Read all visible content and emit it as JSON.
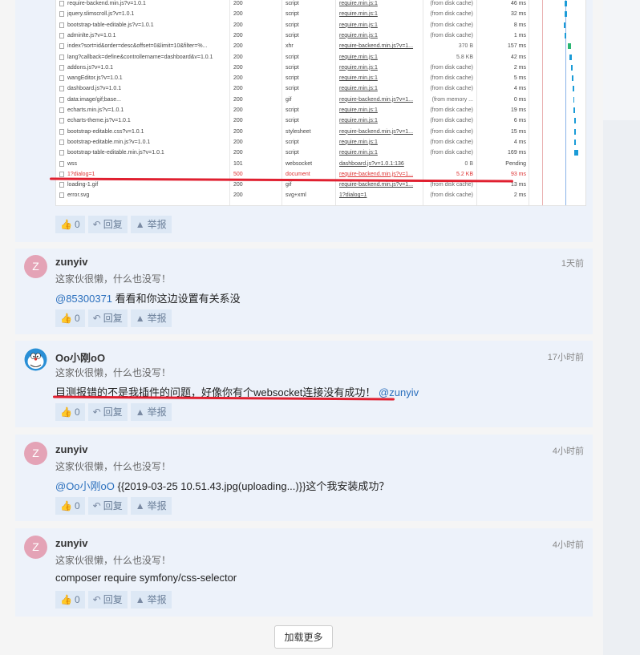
{
  "network": {
    "rows": [
      {
        "name": "require-backend.min.js?v=1.0.1",
        "status": "200",
        "type": "script",
        "initiator": "require.min.js:1",
        "size": "(from disk cache)",
        "time": "46 ms"
      },
      {
        "name": "jquery.slimscroll.js?v=1.0.1",
        "status": "200",
        "type": "script",
        "initiator": "require.min.js:1",
        "size": "(from disk cache)",
        "time": "32 ms"
      },
      {
        "name": "bootstrap-table-editable.js?v=1.0.1",
        "status": "200",
        "type": "script",
        "initiator": "require.min.js:1",
        "size": "(from disk cache)",
        "time": "8 ms"
      },
      {
        "name": "adminlte.js?v=1.0.1",
        "status": "200",
        "type": "script",
        "initiator": "require.min.js:1",
        "size": "(from disk cache)",
        "time": "1 ms"
      },
      {
        "name": "index?sort=id&order=desc&offset=0&limit=10&filter=%...",
        "status": "200",
        "type": "xhr",
        "initiator": "require-backend.min.js?v=1...",
        "size": "370 B",
        "time": "157 ms"
      },
      {
        "name": "lang?callback=define&controllername=dashboard&v=1.0.1",
        "status": "200",
        "type": "script",
        "initiator": "require.min.js:1",
        "size": "5.8 KB",
        "time": "42 ms"
      },
      {
        "name": "addons.js?v=1.0.1",
        "status": "200",
        "type": "script",
        "initiator": "require.min.js:1",
        "size": "(from disk cache)",
        "time": "2 ms"
      },
      {
        "name": "wangEditor.js?v=1.0.1",
        "status": "200",
        "type": "script",
        "initiator": "require.min.js:1",
        "size": "(from disk cache)",
        "time": "5 ms"
      },
      {
        "name": "dashboard.js?v=1.0.1",
        "status": "200",
        "type": "script",
        "initiator": "require.min.js:1",
        "size": "(from disk cache)",
        "time": "4 ms"
      },
      {
        "name": "data:image/gif;base...",
        "status": "200",
        "type": "gif",
        "initiator": "require-backend.min.js?v=1...",
        "size": "(from memory ...",
        "time": "0 ms"
      },
      {
        "name": "echarts.min.js?v=1.0.1",
        "status": "200",
        "type": "script",
        "initiator": "require.min.js:1",
        "size": "(from disk cache)",
        "time": "19 ms"
      },
      {
        "name": "echarts-theme.js?v=1.0.1",
        "status": "200",
        "type": "script",
        "initiator": "require.min.js:1",
        "size": "(from disk cache)",
        "time": "6 ms"
      },
      {
        "name": "bootstrap-editable.css?v=1.0.1",
        "status": "200",
        "type": "stylesheet",
        "initiator": "require-backend.min.js?v=1...",
        "size": "(from disk cache)",
        "time": "15 ms"
      },
      {
        "name": "bootstrap-editable.min.js?v=1.0.1",
        "status": "200",
        "type": "script",
        "initiator": "require.min.js:1",
        "size": "(from disk cache)",
        "time": "4 ms"
      },
      {
        "name": "bootstrap-table-editable.min.js?v=1.0.1",
        "status": "200",
        "type": "script",
        "initiator": "require.min.js:1",
        "size": "(from disk cache)",
        "time": "169 ms"
      },
      {
        "name": "wss",
        "status": "101",
        "type": "websocket",
        "initiator": "dashboard.js?v=1.0.1:136",
        "size": "0 B",
        "time": "Pending"
      },
      {
        "name": "1?dialog=1",
        "status": "500",
        "type": "document",
        "initiator": "require-backend.min.js?v=1...",
        "size": "5.2 KB",
        "time": "93 ms",
        "error": true
      },
      {
        "name": "loading-1.gif",
        "status": "200",
        "type": "gif",
        "initiator": "require-backend.min.js?v=1...",
        "size": "(from disk cache)",
        "time": "13 ms"
      },
      {
        "name": "error.svg",
        "status": "200",
        "type": "svg+xml",
        "initiator": "1?dialog=1",
        "size": "(from disk cache)",
        "time": "2 ms"
      }
    ]
  },
  "actions": {
    "like_count": "0",
    "reply": "回复",
    "report": "举报"
  },
  "comments": [
    {
      "avatar": "Z",
      "user": "zunyiv",
      "signature": "这家伙很懒，什么也没写！",
      "time": "1天前",
      "mention": "@85300371",
      "text": " 看看和你这边设置有关系没"
    },
    {
      "avatar": "",
      "user": "Oo小刚oO",
      "signature": "这家伙很懒，什么也没写！",
      "time": "17小时前",
      "text": "目测报错的不是我插件的问题，好像你有个websocket连接没有成功！",
      "mention": "@zunyiv"
    },
    {
      "avatar": "Z",
      "user": "zunyiv",
      "signature": "这家伙很懒，什么也没写！",
      "time": "4小时前",
      "mention": "@Oo小刚oO",
      "text": " {{2019-03-25 10.51.43.jpg(uploading...)}}这个我安装成功？"
    },
    {
      "avatar": "Z",
      "user": "zunyiv",
      "signature": "这家伙很懒，什么也没写！",
      "time": "4小时前",
      "text": "composer require symfony/css-selector"
    }
  ],
  "load_more": "加载更多",
  "colors": {
    "accent": "#2a6fbd",
    "card": "#edf2fa",
    "error": "#e02030"
  }
}
